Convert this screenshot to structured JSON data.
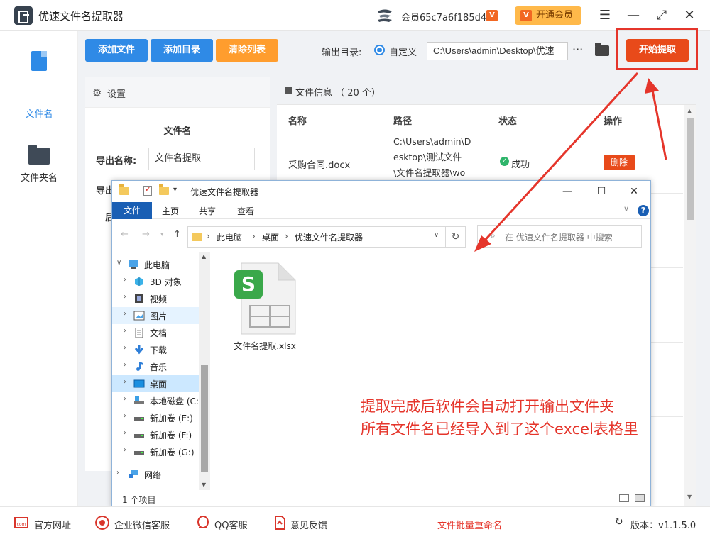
{
  "app": {
    "title": "优速文件名提取器",
    "member_id": "会员65c7a6f185d4",
    "vip_badge": "V",
    "open_vip_label": "开通会员",
    "menu_icon": "☰",
    "minimize_icon": "—",
    "maximize_icon": "⤢",
    "close_icon": "✕"
  },
  "sidebar": {
    "items": [
      {
        "label": "文件名",
        "icon": "file-icon",
        "active": true
      },
      {
        "label": "文件夹名",
        "icon": "folder-icon",
        "active": false
      }
    ]
  },
  "toolbar": {
    "add_file": "添加文件",
    "add_dir": "添加目录",
    "clear_list": "清除列表",
    "output_label": "输出目录:",
    "radio_label": "自定义",
    "output_path": "C:\\Users\\admin\\Desktop\\优速",
    "more_label": "···",
    "start_label": "开始提取"
  },
  "settings": {
    "title": "设置",
    "section": "文件名",
    "export_name_label": "导出名称:",
    "export_name_value": "文件名提取",
    "label2": "导出",
    "label3": "后"
  },
  "file_info": {
    "title": "文件信息 （ 20 个）",
    "columns": [
      "名称",
      "路径",
      "状态",
      "操作"
    ],
    "rows": [
      {
        "name": "采购合同.docx",
        "path": "C:\\Users\\admin\\D\nesktop\\测试文件\n\\文件名提取器\\wo",
        "status": "成功",
        "action": "删除"
      }
    ]
  },
  "explorer": {
    "title": "优速文件名提取器",
    "ribbon_tabs": [
      "文件",
      "主页",
      "共享",
      "查看"
    ],
    "address": [
      "此电脑",
      "桌面",
      "优速文件名提取器"
    ],
    "search_placeholder": "在 优速文件名提取器 中搜索",
    "tree": [
      {
        "label": "此电脑",
        "level": 0,
        "expanded": true,
        "selected": false,
        "icon": "computer-icon"
      },
      {
        "label": "3D 对象",
        "level": 1,
        "selected": false,
        "icon": "cube-icon"
      },
      {
        "label": "视频",
        "level": 1,
        "selected": false,
        "icon": "video-icon"
      },
      {
        "label": "图片",
        "level": 1,
        "selected": false,
        "icon": "picture-icon",
        "hover": true
      },
      {
        "label": "文档",
        "level": 1,
        "selected": false,
        "icon": "document-icon"
      },
      {
        "label": "下载",
        "level": 1,
        "selected": false,
        "icon": "download-icon"
      },
      {
        "label": "音乐",
        "level": 1,
        "selected": false,
        "icon": "music-icon"
      },
      {
        "label": "桌面",
        "level": 1,
        "selected": true,
        "icon": "desktop-icon"
      },
      {
        "label": "本地磁盘 (C:",
        "level": 1,
        "selected": false,
        "icon": "drive-icon"
      },
      {
        "label": "新加卷 (E:)",
        "level": 1,
        "selected": false,
        "icon": "drive-icon"
      },
      {
        "label": "新加卷 (F:)",
        "level": 1,
        "selected": false,
        "icon": "drive-icon"
      },
      {
        "label": "新加卷 (G:)",
        "level": 1,
        "selected": false,
        "icon": "drive-icon"
      },
      {
        "label": "网络",
        "level": 0,
        "selected": false,
        "icon": "network-icon"
      }
    ],
    "file": {
      "name": "文件名提取.xlsx",
      "icon": "xlsx-icon"
    },
    "status": "1 个项目"
  },
  "annotation": {
    "line1": "提取完成后软件会自动打开输出文件夹",
    "line2": "所有文件名已经导入到了这个excel表格里"
  },
  "bottom": {
    "links": [
      "官方网址",
      "企业微信客服",
      "QQ客服",
      "意见反馈"
    ],
    "center": "文件批量重命名",
    "version": "版本：v1.1.5.0"
  },
  "colors": {
    "primary_blue": "#2f8ae6",
    "orange": "#ff9d2e",
    "start_red": "#e84a1a",
    "annotation_red": "#e5352b",
    "excel_green": "#3aa84a"
  }
}
